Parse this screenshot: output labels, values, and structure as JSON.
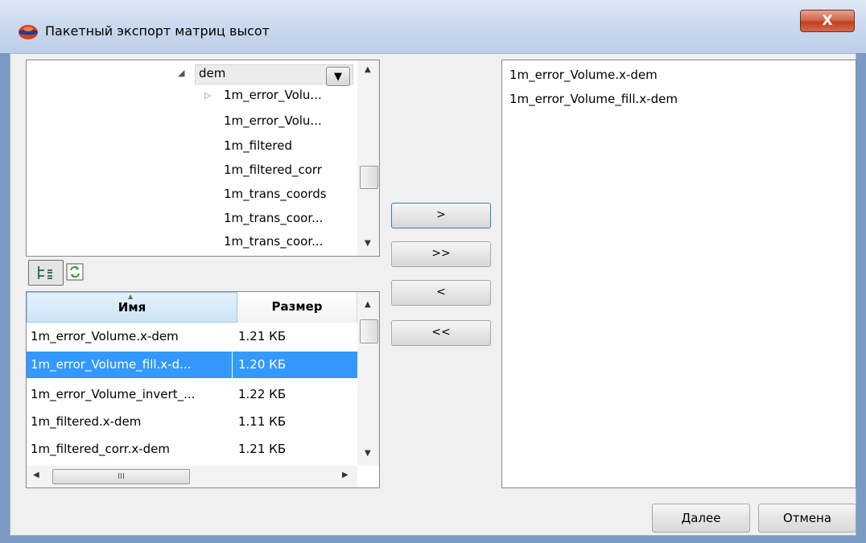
{
  "window": {
    "title": "Пакетный экспорт матриц высот",
    "close_glyph": "X"
  },
  "tree": {
    "items": [
      {
        "label": "dem",
        "expander": "◢"
      },
      {
        "label": "1m_error_Volu...",
        "expander": "▷"
      },
      {
        "label": "1m_error_Volu..."
      },
      {
        "label": "1m_filtered"
      },
      {
        "label": "1m_filtered_corr"
      },
      {
        "label": "1m_trans_coords"
      },
      {
        "label": "1m_trans_coor..."
      },
      {
        "label": "1m_trans_coor..."
      }
    ]
  },
  "toolbar": {
    "tree_view_icon": "tree-view-icon",
    "refresh_icon": "refresh-icon"
  },
  "file_table": {
    "columns": [
      "Имя",
      "Размер"
    ],
    "sort_indicator": "▲",
    "rows": [
      {
        "name": "1m_error_Volume.x-dem",
        "size": "1.21 КБ"
      },
      {
        "name": "1m_error_Volume_fill.x-d...",
        "size": "1.20 КБ",
        "selected": true
      },
      {
        "name": "1m_error_Volume_invert_...",
        "size": "1.22 КБ"
      },
      {
        "name": "1m_filtered.x-dem",
        "size": "1.11 КБ"
      },
      {
        "name": "1m_filtered_corr.x-dem",
        "size": "1.21 КБ"
      }
    ],
    "hscroll_grip": "III"
  },
  "transfer_buttons": {
    "add": ">",
    "add_all": ">>",
    "remove": "<",
    "remove_all": "<<"
  },
  "selected_list": {
    "items": [
      "1m_error_Volume.x-dem",
      "1m_error_Volume_fill.x-dem"
    ]
  },
  "footer": {
    "next_label": "Далее",
    "cancel_label": "Отмена"
  },
  "colors": {
    "selection": "#3399ff",
    "close_button": "#c0411f"
  }
}
